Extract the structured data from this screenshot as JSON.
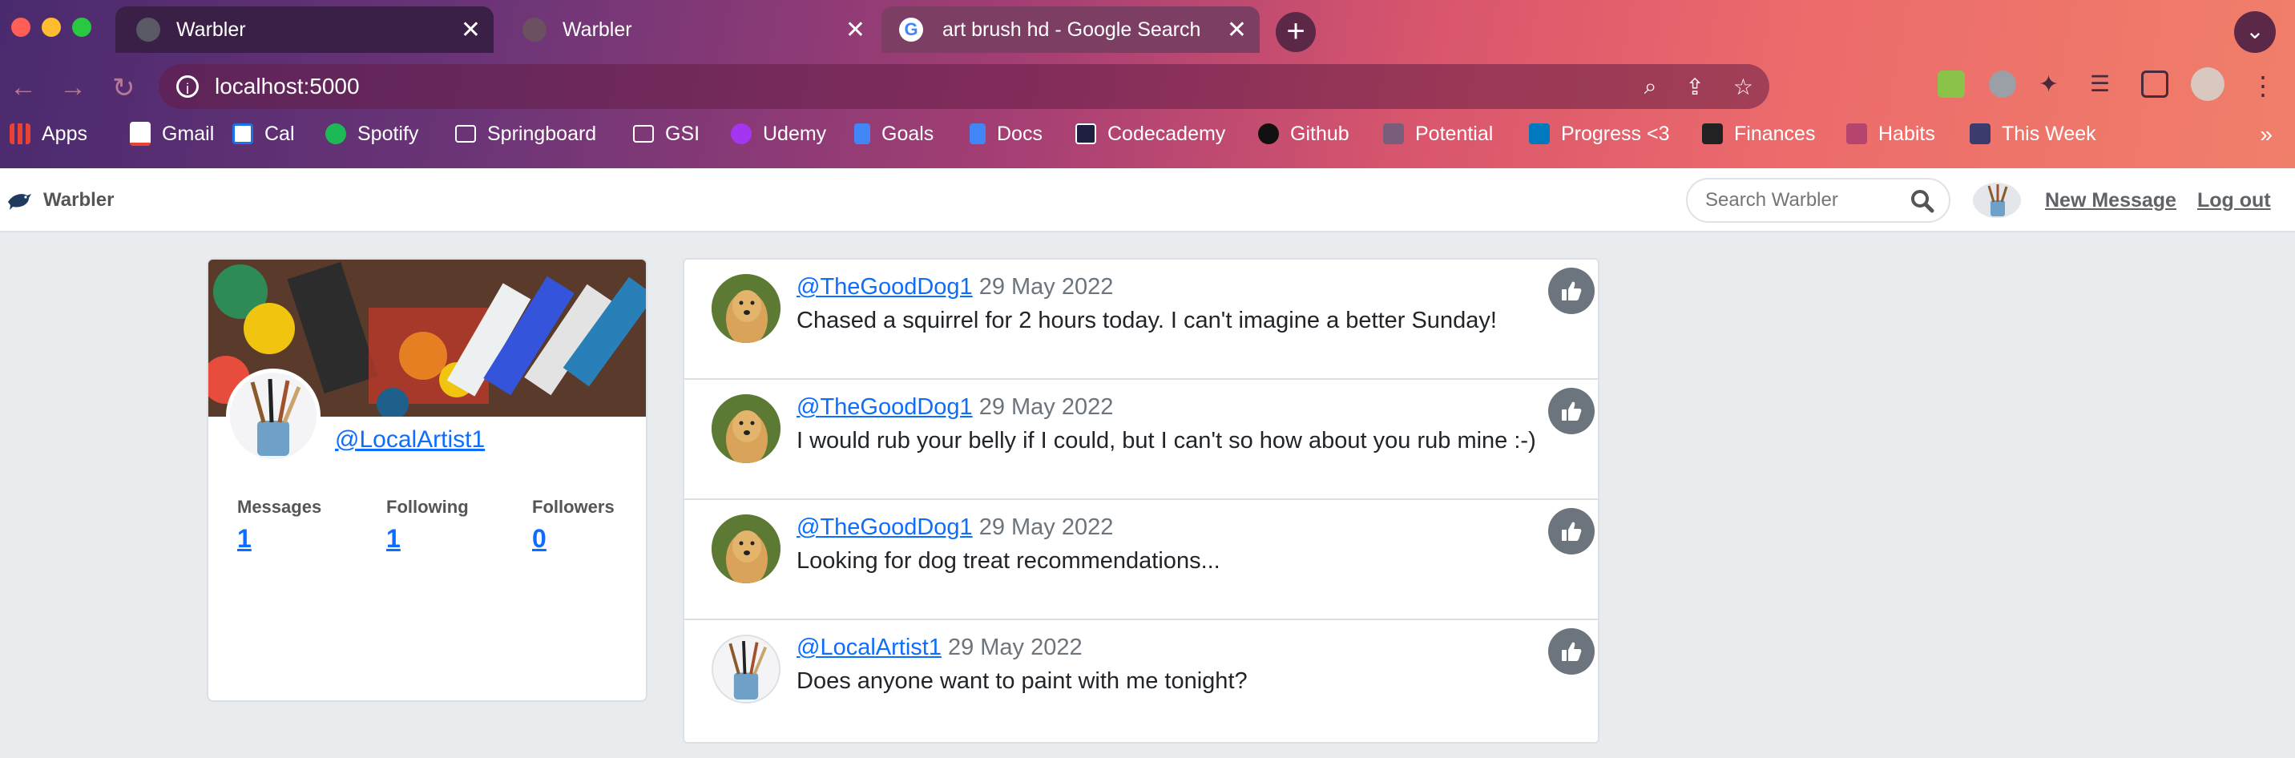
{
  "browser": {
    "tabs": [
      {
        "title": "Warbler",
        "active": false
      },
      {
        "title": "Warbler",
        "active": false
      },
      {
        "title": "art brush hd - Google Search",
        "active": true
      }
    ],
    "url": "localhost:5000",
    "bookmarks": [
      {
        "label": "Apps",
        "icon": "apps-grid-icon",
        "color": "#e94235"
      },
      {
        "label": "Gmail",
        "icon": "gmail-icon",
        "color": "#ea4335"
      },
      {
        "label": "Cal",
        "icon": "calendar-icon",
        "color": "#1a73e8"
      },
      {
        "label": "Spotify",
        "icon": "spotify-icon",
        "color": "#1db954"
      },
      {
        "label": "Springboard",
        "icon": "folder-icon",
        "color": "#ffffff"
      },
      {
        "label": "GSI",
        "icon": "folder-icon",
        "color": "#ffffff"
      },
      {
        "label": "Udemy",
        "icon": "udemy-icon",
        "color": "#a435f0"
      },
      {
        "label": "Goals",
        "icon": "docs-icon",
        "color": "#4285f4"
      },
      {
        "label": "Docs",
        "icon": "docs-icon",
        "color": "#4285f4"
      },
      {
        "label": "Codecademy",
        "icon": "codecademy-icon",
        "color": "#1f1f3f"
      },
      {
        "label": "Github",
        "icon": "github-icon",
        "color": "#111111"
      },
      {
        "label": "Potential",
        "icon": "board-icon",
        "color": "#7a5d7a"
      },
      {
        "label": "Progress <3",
        "icon": "trello-icon",
        "color": "#0079bf"
      },
      {
        "label": "Finances",
        "icon": "board-icon",
        "color": "#222222"
      },
      {
        "label": "Habits",
        "icon": "board-icon",
        "color": "#b5446e"
      },
      {
        "label": "This Week",
        "icon": "board-icon",
        "color": "#3b3b6d"
      }
    ],
    "more_label": "»"
  },
  "navbar": {
    "brand": "Warbler",
    "search_placeholder": "Search Warbler",
    "new_message": "New Message",
    "logout": "Log out"
  },
  "profile": {
    "username": "@LocalArtist1",
    "stats": [
      {
        "label": "Messages",
        "value": "1"
      },
      {
        "label": "Following",
        "value": "1"
      },
      {
        "label": "Followers",
        "value": "0"
      }
    ]
  },
  "messages": [
    {
      "user": "@TheGoodDog1",
      "date": "29 May 2022",
      "text": "Chased a squirrel for 2 hours today. I can't imagine a better Sunday!",
      "avatar": "dog"
    },
    {
      "user": "@TheGoodDog1",
      "date": "29 May 2022",
      "text": "I would rub your belly if I could, but I can't so how about you rub mine :-)",
      "avatar": "dog"
    },
    {
      "user": "@TheGoodDog1",
      "date": "29 May 2022",
      "text": "Looking for dog treat recommendations...",
      "avatar": "dog"
    },
    {
      "user": "@LocalArtist1",
      "date": "29 May 2022",
      "text": "Does anyone want to paint with me tonight?",
      "avatar": "brushes"
    }
  ],
  "colors": {
    "link": "#0d6efd",
    "like_button": "#6c757d"
  }
}
